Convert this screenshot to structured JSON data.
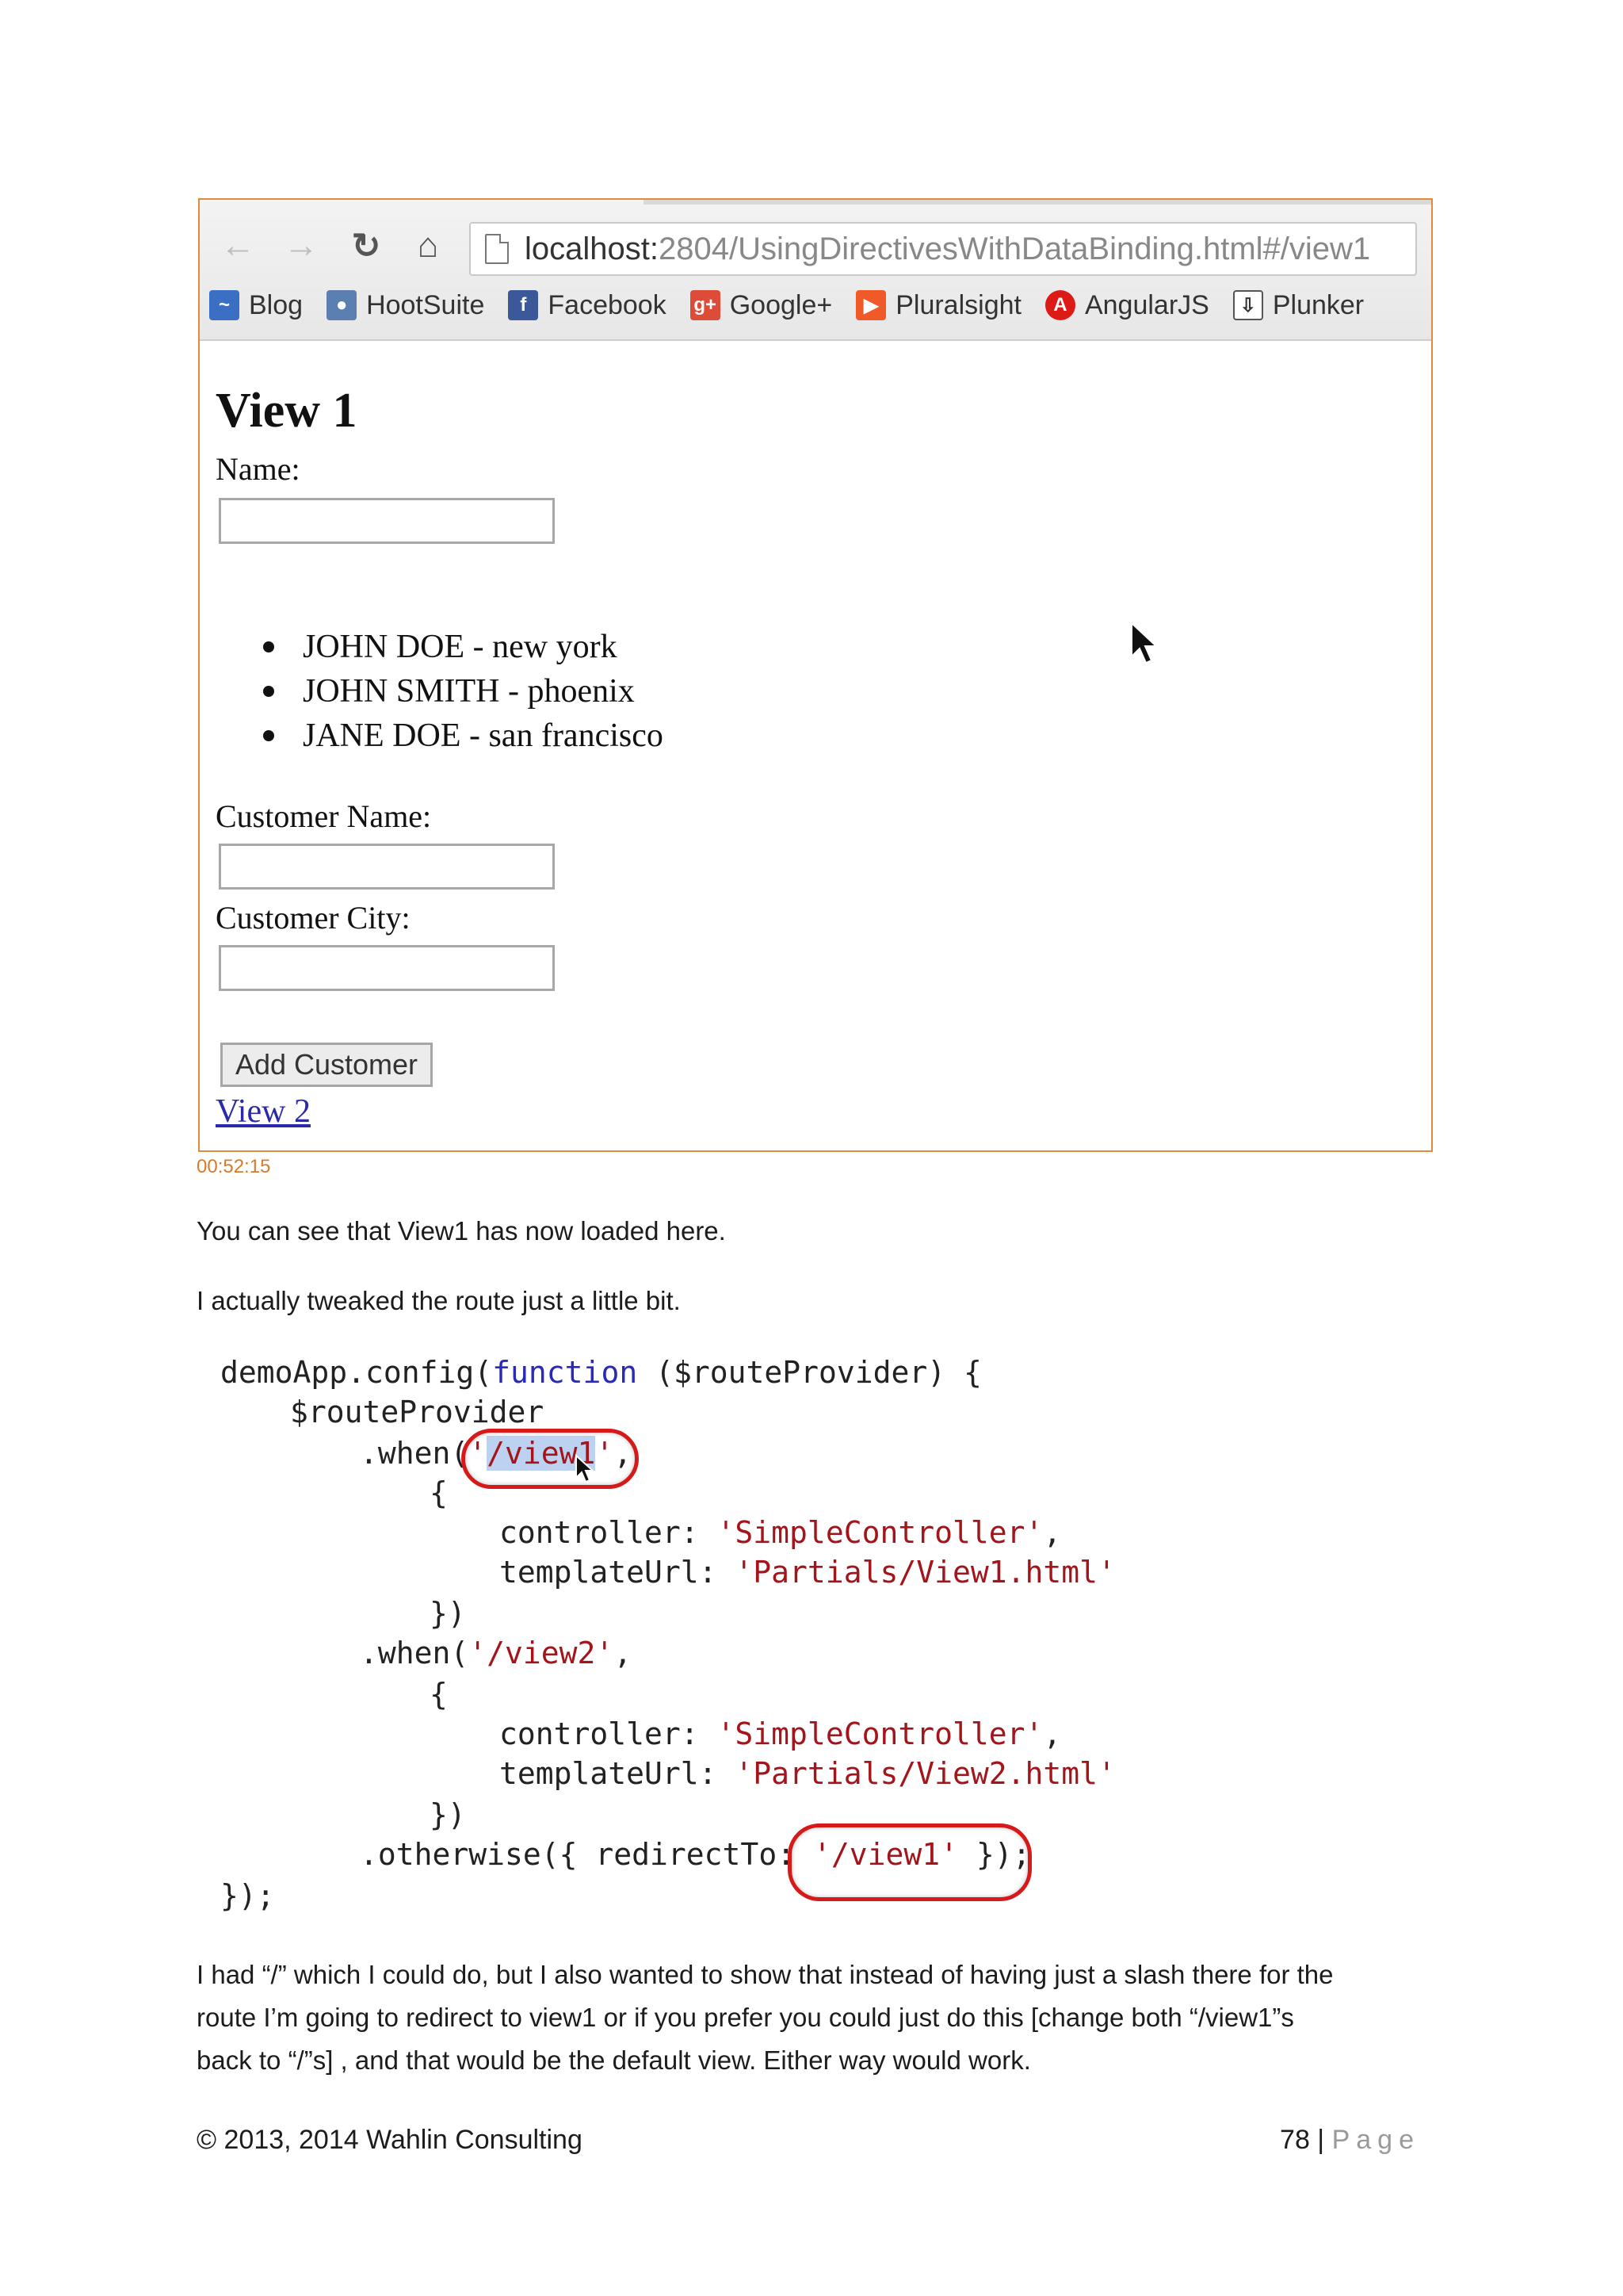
{
  "browser": {
    "url_host": "localhost:",
    "url_rest": "2804/UsingDirectivesWithDataBinding.html#/view1",
    "bookmarks": [
      {
        "label": "Blog",
        "icon": "blog-icon",
        "color": "#3a6fc4"
      },
      {
        "label": "HootSuite",
        "icon": "hootsuite-icon",
        "color": "#5a7fb0"
      },
      {
        "label": "Facebook",
        "icon": "facebook-icon",
        "color": "#3b5998"
      },
      {
        "label": "Google+",
        "icon": "google-plus-icon",
        "color": "#dd4b39"
      },
      {
        "label": "Pluralsight",
        "icon": "pluralsight-icon",
        "color": "#f05a28"
      },
      {
        "label": "AngularJS",
        "icon": "angularjs-icon",
        "color": "#dd1b16"
      },
      {
        "label": "Plunker",
        "icon": "plunker-icon",
        "color": "#555555"
      }
    ],
    "page": {
      "heading": "View 1",
      "name_label": "Name:",
      "customers": [
        "JOHN DOE - new york",
        "JOHN SMITH - phoenix",
        "JANE DOE - san francisco"
      ],
      "customer_name_label": "Customer Name:",
      "customer_city_label": "Customer City:",
      "add_button": "Add Customer",
      "view2_link": "View 2"
    }
  },
  "timestamp": "00:52:15",
  "para1": "You can see that View1 has now loaded here.",
  "para2": "I actually tweaked the route just a little bit.",
  "code": {
    "l1a": "demoApp.config(",
    "l1kw": "function",
    "l1b": " ($routeProvider) {",
    "l2": "$routeProvider",
    "l3a": ".when(",
    "l3q1": "'",
    "l3sel": "/view1",
    "l3q2": "'",
    "l3b": ",",
    "brace_open": "{",
    "ctrl_key": "controller: ",
    "ctrl_val": "'SimpleController'",
    "comma": ",",
    "tpl_key": "templateUrl: ",
    "tpl_val1": "'Partials/View1.html'",
    "brace_close": "})",
    "l8a": ".when(",
    "l8s": "'/view2'",
    "l8b": ",",
    "tpl_val2": "'Partials/View2.html'",
    "l14a": ".otherwise({ redirectTo: ",
    "l14s": "'/view1'",
    "l14b": " });",
    "l15": "});"
  },
  "para3": [
    "I had “/” which I could do, but I also wanted to show that instead of having just a slash there for the",
    "route I’m going to redirect to view1 or if you prefer you could just do this [change both “/view1”s",
    "back to “/”s] , and that would be the default view. Either way would work."
  ],
  "footer": {
    "copyright": "© 2013, 2014 Wahlin Consulting",
    "page_number": "78",
    "separator": " | ",
    "page_word": "Page"
  }
}
